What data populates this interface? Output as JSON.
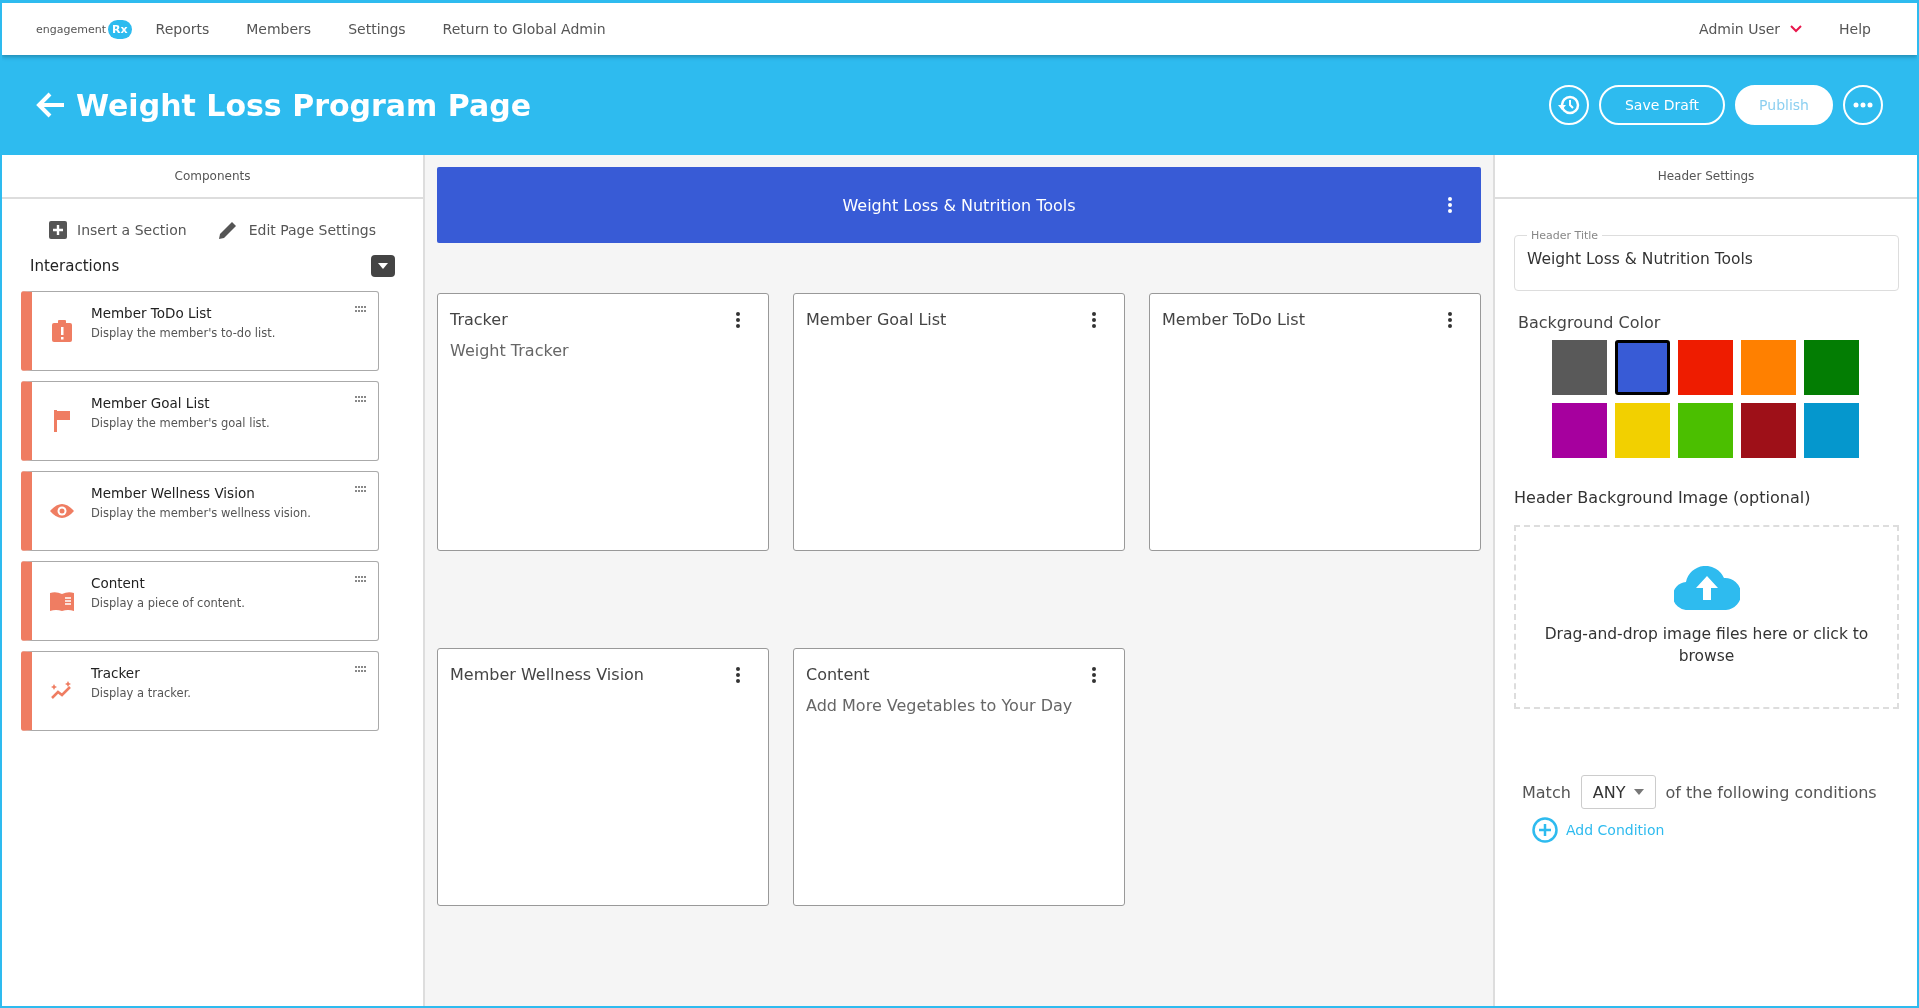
{
  "nav": {
    "logo_text": "engagement",
    "logo_badge": "Rx",
    "links": [
      "Reports",
      "Members",
      "Settings",
      "Return to Global Admin"
    ],
    "user": "Admin User",
    "help": "Help"
  },
  "header": {
    "title": "Weight Loss Program Page",
    "buttons": [
      "Save Draft",
      "Publish"
    ]
  },
  "components_panel": {
    "title": "Components",
    "actions": [
      {
        "kind": "insert",
        "label": "Insert a Section"
      },
      {
        "kind": "edit",
        "label": "Edit Page Settings"
      }
    ],
    "group": "Interactions",
    "items": [
      {
        "kind": "todo",
        "title": "Member ToDo List",
        "description": "Display the member's to-do list."
      },
      {
        "kind": "goal",
        "title": "Member Goal List",
        "description": "Display the member's goal list."
      },
      {
        "kind": "vision",
        "title": "Member Wellness Vision",
        "description": "Display the member's wellness vision."
      },
      {
        "kind": "content",
        "title": "Content",
        "description": "Display a piece of content."
      },
      {
        "kind": "tracker",
        "title": "Tracker",
        "description": "Display a tracker."
      }
    ]
  },
  "canvas": {
    "banner": "Weight Loss & Nutrition Tools",
    "rows": [
      [
        {
          "title": "Tracker",
          "subtitle": "Weight Tracker"
        },
        {
          "title": "Member Goal List"
        },
        {
          "title": "Member ToDo List"
        }
      ],
      [
        {
          "title": "Member Wellness Vision"
        },
        {
          "title": "Content",
          "subtitle": "Add More Vegetables to Your Day"
        }
      ]
    ]
  },
  "settings_panel": {
    "title": "Header Settings",
    "header_title": {
      "label": "Header Title",
      "value": "Weight Loss & Nutrition Tools"
    },
    "background_color_label": "Background Color",
    "colors": [
      {
        "color": "#595959",
        "selected": false
      },
      {
        "color": "#385bd6",
        "selected": true
      },
      {
        "color": "#ee1c00",
        "selected": false
      },
      {
        "color": "#ff8000",
        "selected": false
      },
      {
        "color": "#037d03",
        "selected": false
      },
      {
        "color": "#a6009e",
        "selected": false
      },
      {
        "color": "#f2d000",
        "selected": false
      },
      {
        "color": "#4bbf00",
        "selected": false
      },
      {
        "color": "#9e1018",
        "selected": false
      },
      {
        "color": "#0597cd",
        "selected": false
      }
    ],
    "image_label": "Header Background Image (optional)",
    "dropzone_text": "Drag-and-drop image files here or click to browse",
    "match_label": "Match",
    "match_value": "ANY",
    "match_suffix": "of the following conditions",
    "add_condition": "Add Condition"
  }
}
